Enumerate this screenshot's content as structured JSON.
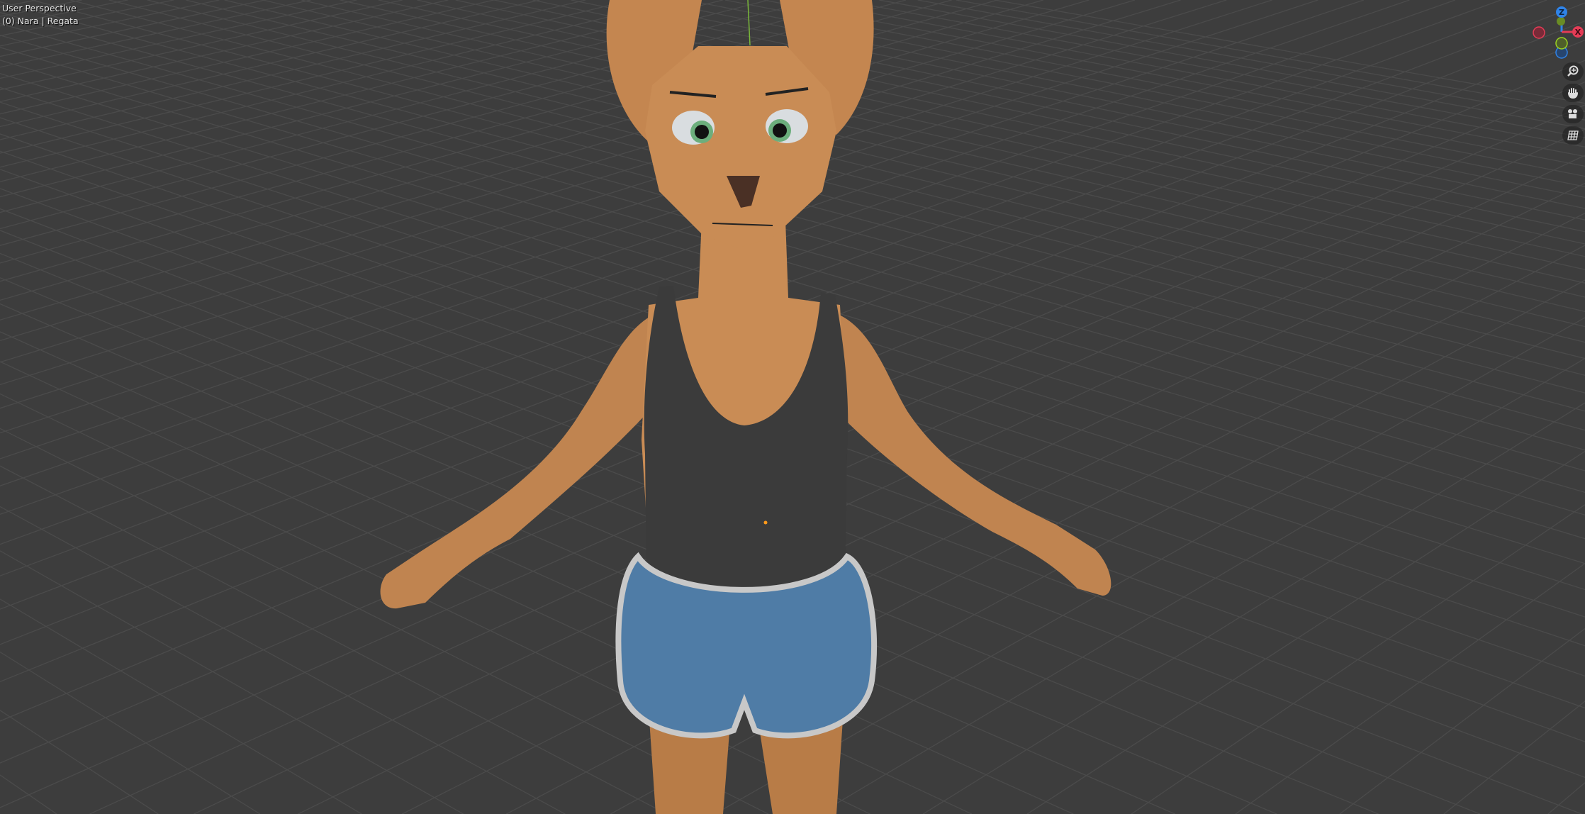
{
  "viewport": {
    "view_name": "User Perspective",
    "object_info": "(0) Nara | Regata"
  },
  "gizmo": {
    "axes": [
      {
        "label": "Z",
        "color": "#2f83e8"
      },
      {
        "label": "X",
        "color": "#e43c56"
      },
      {
        "label": "Y",
        "color": "#7aab29"
      }
    ]
  },
  "nav_tools": [
    {
      "icon": "zoom-icon"
    },
    {
      "icon": "hand-pan-icon"
    },
    {
      "icon": "camera-icon"
    },
    {
      "icon": "grid-perspective-icon"
    }
  ],
  "colors": {
    "background": "#3d3d3d",
    "grid": "#4b4b4b",
    "skin": "#c68a52",
    "tank_top": "#3a3a3a",
    "shorts": "#4d7aa3",
    "origin": "#ff9a1a"
  }
}
